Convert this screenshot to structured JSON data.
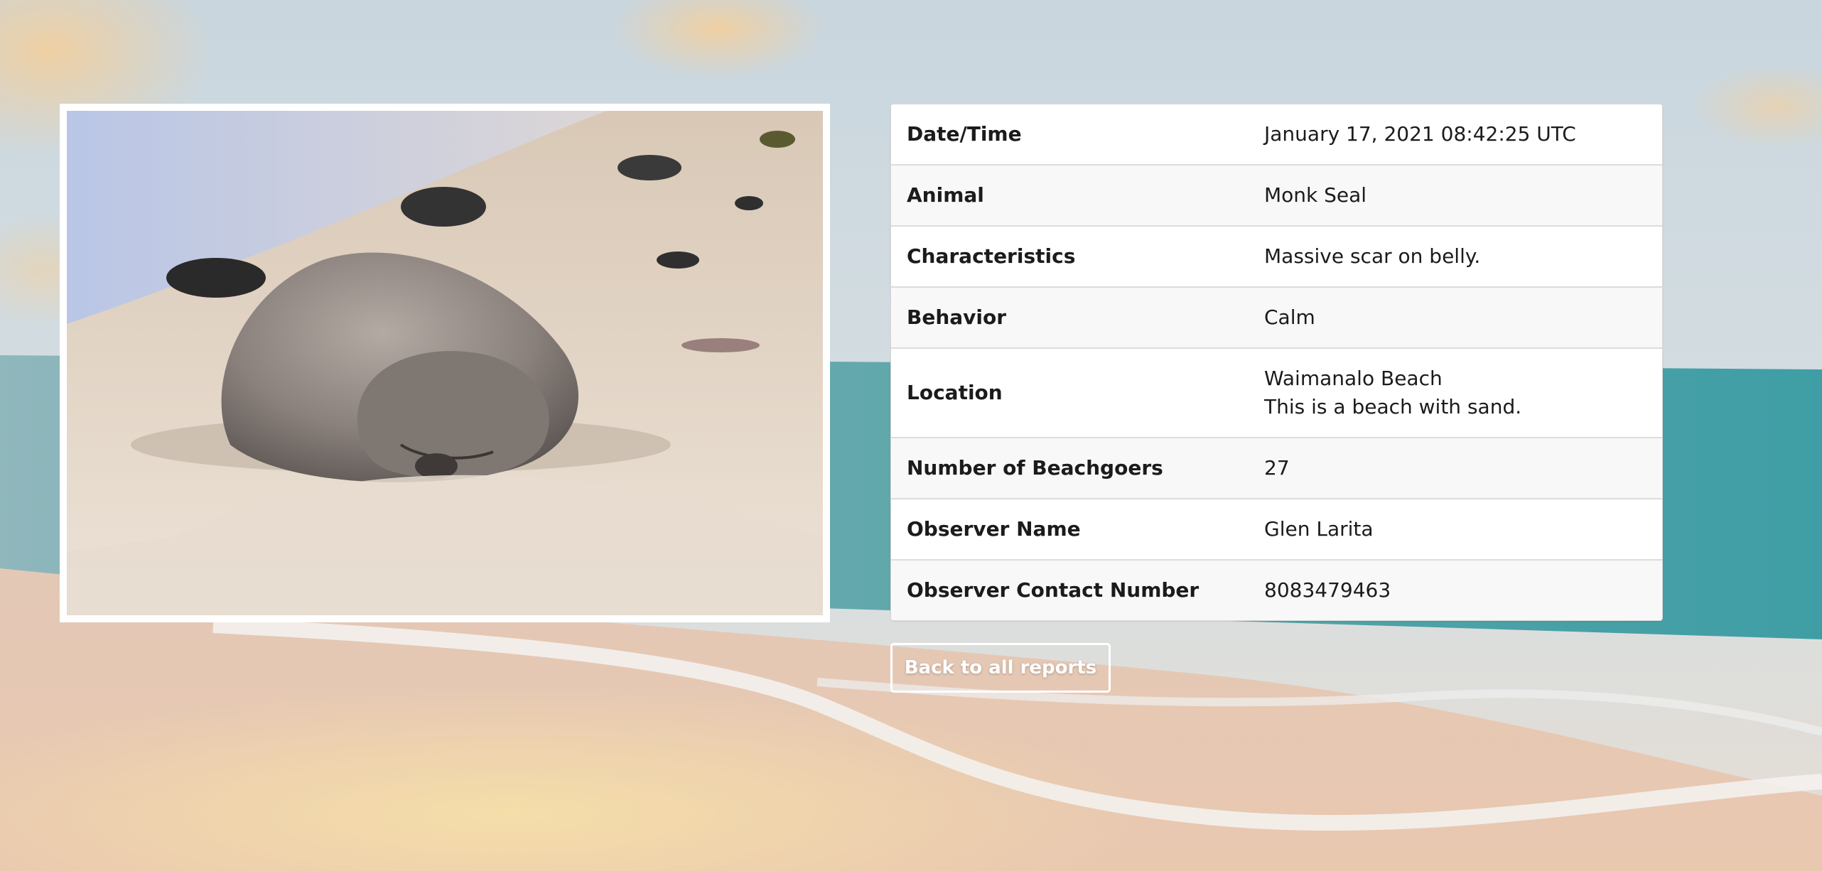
{
  "report": {
    "rows": [
      {
        "label": "Date/Time",
        "value": "January 17, 2021 08:42:25 UTC"
      },
      {
        "label": "Animal",
        "value": "Monk Seal"
      },
      {
        "label": "Characteristics",
        "value": "Massive scar on belly."
      },
      {
        "label": "Behavior",
        "value": "Calm"
      },
      {
        "label": "Location",
        "value": "Waimanalo Beach",
        "value_line2": "This is a beach with sand."
      },
      {
        "label": "Number of Beachgoers",
        "value": "27"
      },
      {
        "label": "Observer Name",
        "value": "Glen Larita"
      },
      {
        "label": "Observer Contact Number",
        "value": "8083479463"
      }
    ]
  },
  "actions": {
    "back_label": "Back to all reports"
  },
  "colors": {
    "button_border": "#ffffff",
    "table_stripe": "#f8f8f8",
    "table_border": "#dcdcdc"
  }
}
